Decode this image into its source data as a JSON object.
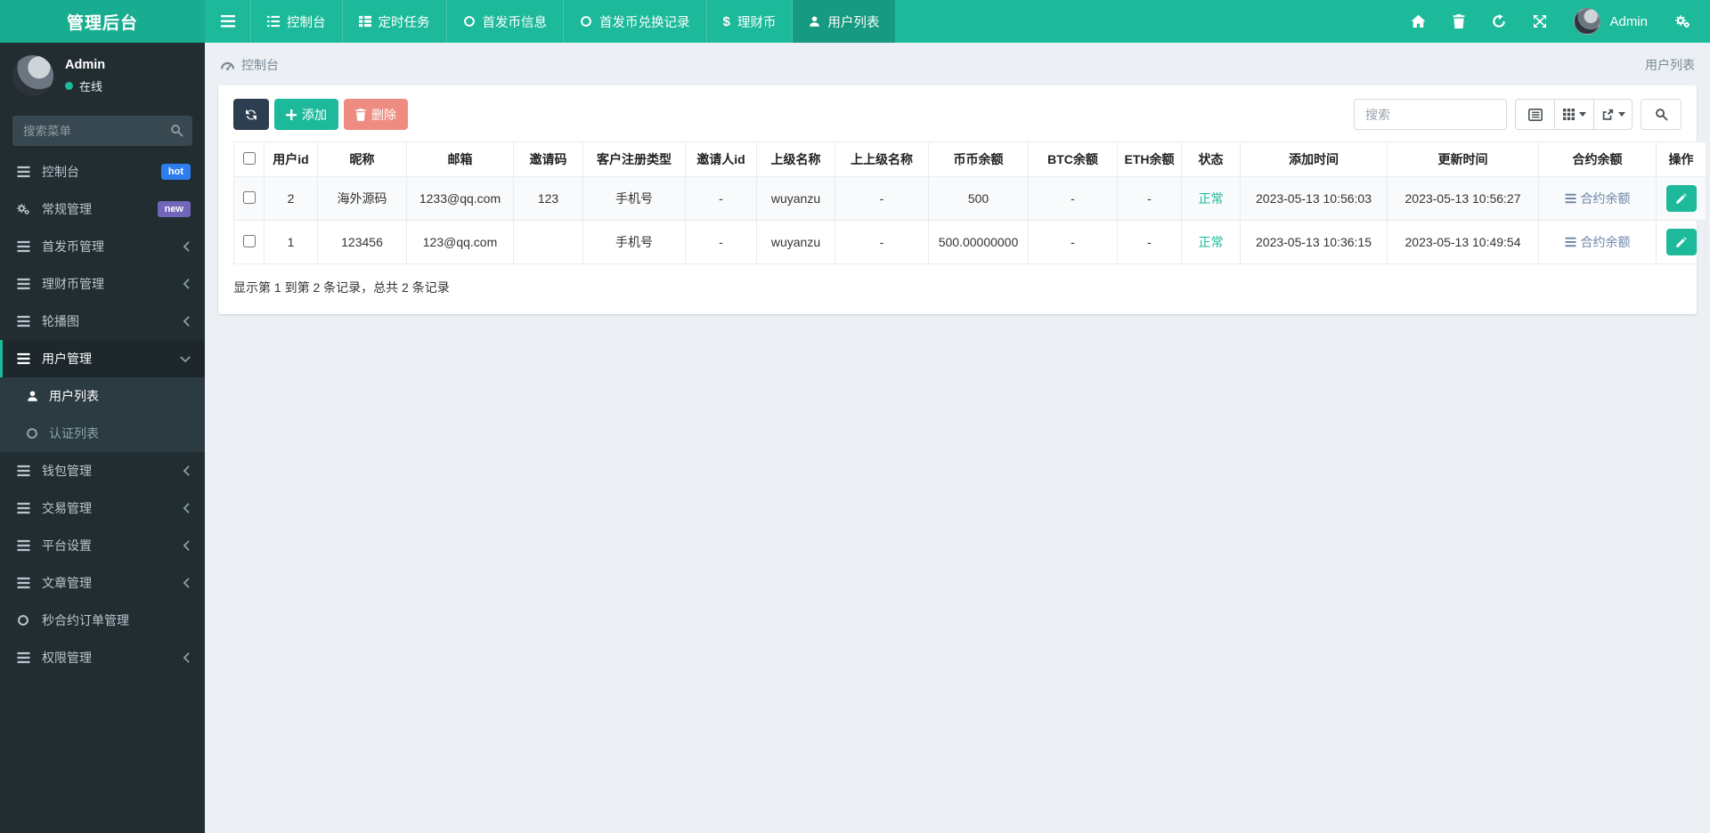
{
  "navbar": {
    "brand": "管理后台",
    "items": [
      {
        "label": "控制台",
        "icon": "list-icon"
      },
      {
        "label": "定时任务",
        "icon": "table-icon"
      },
      {
        "label": "首发币信息",
        "icon": "circle-icon"
      },
      {
        "label": "首发币兑换记录",
        "icon": "circle-icon"
      },
      {
        "label": "理财币",
        "icon": "dollar-icon",
        "dollar": "$"
      },
      {
        "label": "用户列表",
        "icon": "user-icon",
        "active": true
      }
    ],
    "username": "Admin"
  },
  "sidebar": {
    "profile": {
      "name": "Admin",
      "status": "在线"
    },
    "search_placeholder": "搜索菜单",
    "items": [
      {
        "label": "控制台",
        "badge": "hot"
      },
      {
        "label": "常规管理",
        "badge": "new"
      },
      {
        "label": "首发币管理"
      },
      {
        "label": "理财币管理"
      },
      {
        "label": "轮播图"
      },
      {
        "label": "用户管理"
      },
      {
        "label": "用户列表"
      },
      {
        "label": "认证列表"
      },
      {
        "label": "钱包管理"
      },
      {
        "label": "交易管理"
      },
      {
        "label": "平台设置"
      },
      {
        "label": "文章管理"
      },
      {
        "label": "秒合约订单管理"
      },
      {
        "label": "权限管理"
      }
    ]
  },
  "breadcrumb": {
    "left": "控制台",
    "right": "用户列表"
  },
  "toolbar": {
    "add_label": "添加",
    "delete_label": "删除",
    "search_placeholder": "搜索"
  },
  "table": {
    "columns": [
      "用户id",
      "昵称",
      "邮箱",
      "邀请码",
      "客户注册类型",
      "邀请人id",
      "上级名称",
      "上上级名称",
      "币币余额",
      "BTC余额",
      "ETH余额",
      "状态",
      "添加时间",
      "更新时间",
      "合约余额",
      "操作"
    ],
    "rows": [
      {
        "id": "2",
        "nickname": "海外源码",
        "email": "1233@qq.com",
        "invite_code": "123",
        "reg_type": "手机号",
        "inviter_id": "-",
        "parent_name": "wuyanzu",
        "grandparent_name": "-",
        "coin_balance": "500",
        "btc_balance": "-",
        "eth_balance": "-",
        "status": "正常",
        "created_at": "2023-05-13 10:56:03",
        "updated_at": "2023-05-13 10:56:27",
        "contract_label": "合约余额"
      },
      {
        "id": "1",
        "nickname": "123456",
        "email": "123@qq.com",
        "invite_code": "",
        "reg_type": "手机号",
        "inviter_id": "-",
        "parent_name": "wuyanzu",
        "grandparent_name": "-",
        "coin_balance": "500.00000000",
        "btc_balance": "-",
        "eth_balance": "-",
        "status": "正常",
        "created_at": "2023-05-13 10:36:15",
        "updated_at": "2023-05-13 10:49:54",
        "contract_label": "合约余额"
      }
    ],
    "summary": "显示第 1 到第 2 条记录，总共 2 条记录"
  },
  "colors": {
    "navbar_teal": "#1cb99a",
    "brand_teal": "#18ad90",
    "active_tab_teal": "#169a81",
    "sidebar_dark": "#222d32",
    "submenu_dark": "#2c3b41",
    "accent_teal": "#1cb99a",
    "badge_hot_blue": "#2d7cf0",
    "badge_new_purple": "#7266ba",
    "refresh_button_navy": "#2c3e50",
    "delete_button_salmon": "#ef8c82",
    "status_ok_green": "#1cb99a",
    "contract_link_blue": "#6d87a8",
    "page_background": "#ecf0f5"
  }
}
